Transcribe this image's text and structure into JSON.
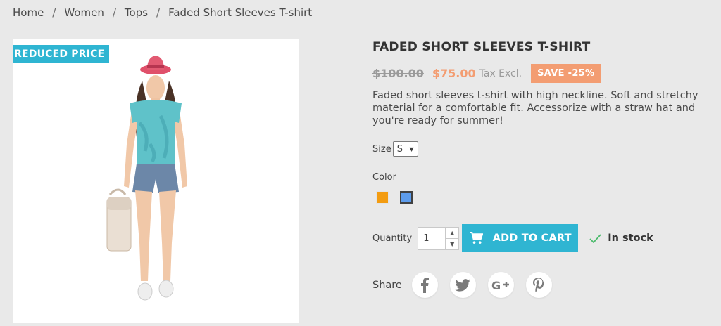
{
  "breadcrumb": {
    "items": [
      "Home",
      "Women",
      "Tops",
      "Faded Short Sleeves T-shirt"
    ],
    "separator": "/"
  },
  "product": {
    "flag": "REDUCED PRICE",
    "title": "FADED SHORT SLEEVES T-SHIRT",
    "regular_price": "$100.00",
    "price": "$75.00",
    "tax_label": "Tax Excl.",
    "discount": "SAVE -25%",
    "description": "Faded short sleeves t-shirt with high neckline. Soft and stretchy material for a comfortable fit. Accessorize with a straw hat and you're ready for summer!"
  },
  "size": {
    "label": "Size",
    "selected": "S",
    "options": [
      "S"
    ]
  },
  "color": {
    "label": "Color",
    "swatches": [
      {
        "name": "orange",
        "hex": "#f39c11",
        "selected": false
      },
      {
        "name": "blue",
        "hex": "#5d9cec",
        "selected": true
      }
    ]
  },
  "quantity": {
    "label": "Quantity",
    "value": "1"
  },
  "cart": {
    "label": "ADD TO CART"
  },
  "availability": {
    "label": "In stock"
  },
  "share": {
    "label": "Share",
    "networks": [
      "facebook-icon",
      "twitter-icon",
      "google-plus-icon",
      "pinterest-icon"
    ]
  },
  "colors": {
    "accent": "#2fb5d2",
    "sale": "#f39d72",
    "background": "#e9e9e9"
  }
}
